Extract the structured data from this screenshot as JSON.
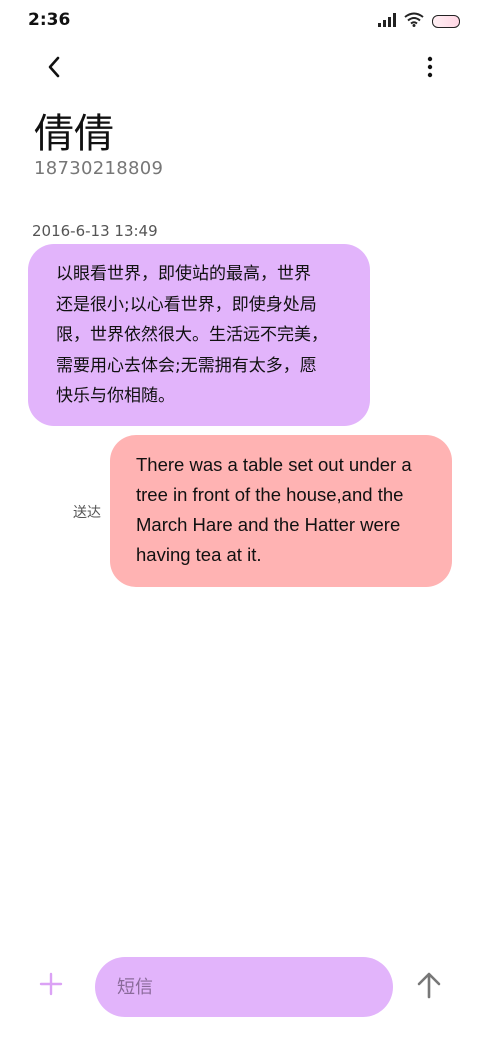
{
  "status_bar": {
    "time": "2:36",
    "icons": [
      "signal-icon",
      "wifi-icon",
      "battery-icon"
    ]
  },
  "header": {
    "back_icon": "chevron-left-icon",
    "more_icon": "more-vertical-icon"
  },
  "contact": {
    "name": "倩倩",
    "number": "18730218809"
  },
  "conversation": {
    "timestamp": "2016-6-13 13:49",
    "messages": [
      {
        "direction": "received",
        "text": "以眼看世界，即使站的最高，世界\n还是很小;以心看世界，即使身处局\n限，世界依然很大。生活远不完美，\n需要用心去体会;无需拥有太多，愿\n快乐与你相随。",
        "bubble_color": "#e2b4fb"
      },
      {
        "direction": "sent",
        "text": "There was a table set out under a tree in front of the house,and the March Hare and the Hatter were having tea at it.",
        "status": "送达",
        "bubble_color": "#ffb3b3"
      }
    ]
  },
  "composer": {
    "add_icon": "plus-icon",
    "placeholder": "短信",
    "value": "",
    "send_icon": "arrow-up-icon",
    "accent_color": "#e2b4fb"
  }
}
